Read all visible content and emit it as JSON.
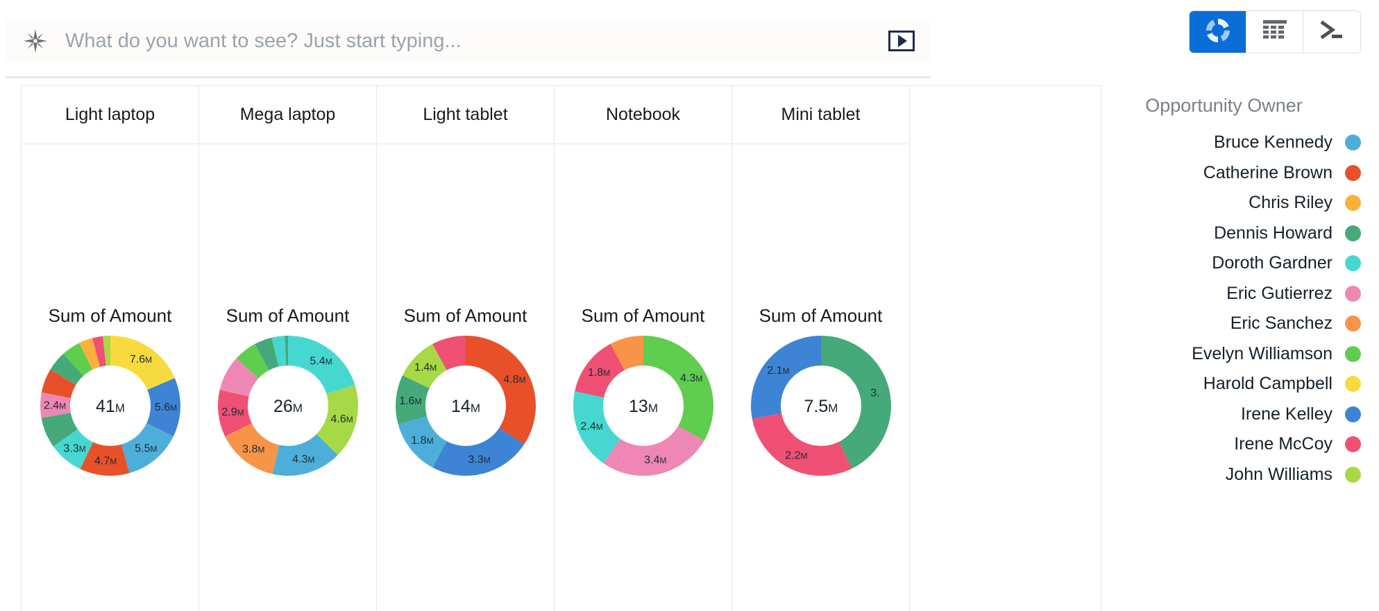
{
  "search": {
    "placeholder": "What do you want to see? Just start typing...",
    "value": "",
    "icon": "sparkle-icon",
    "run_icon": "play-icon"
  },
  "view_switch": {
    "buttons": [
      {
        "name": "chart-view",
        "icon": "donut-chart-icon",
        "active": true
      },
      {
        "name": "table-view",
        "icon": "table-grid-icon",
        "active": false
      },
      {
        "name": "console-view",
        "icon": "terminal-prompt-icon",
        "active": false
      }
    ],
    "active_color": "#0a6ed6"
  },
  "legend": {
    "title": "Opportunity Owner",
    "items": [
      {
        "label": "Bruce Kennedy",
        "color": "#4dafd9"
      },
      {
        "label": "Catherine Brown",
        "color": "#e8502a"
      },
      {
        "label": "Chris Riley",
        "color": "#fbb03b"
      },
      {
        "label": "Dennis Howard",
        "color": "#45a97a"
      },
      {
        "label": "Doroth Gardner",
        "color": "#46d8d0"
      },
      {
        "label": "Eric Gutierrez",
        "color": "#ee87b4"
      },
      {
        "label": "Eric Sanchez",
        "color": "#f79448"
      },
      {
        "label": "Evelyn Williamson",
        "color": "#5fcd4e"
      },
      {
        "label": "Harold Campbell",
        "color": "#f7da3e"
      },
      {
        "label": "Irene Kelley",
        "color": "#3d84d4"
      },
      {
        "label": "Irene McCoy",
        "color": "#ef5073"
      },
      {
        "label": "John Williams",
        "color": "#a6d945"
      }
    ]
  },
  "chart_data": {
    "type": "pie",
    "title": "Sum of Amount by Opportunity Owner and Product",
    "measure_label": "Sum of Amount",
    "dimension_label": "Opportunity Owner",
    "categories": [
      "Light laptop",
      "Mega laptop",
      "Light tablet",
      "Notebook",
      "Mini tablet"
    ],
    "charts": [
      {
        "category": "Light laptop",
        "title": "Sum of Amount",
        "total": "41",
        "total_suffix": "M",
        "slices": [
          {
            "owner": "Harold Campbell",
            "color": "#f7da3e",
            "value": 7.6,
            "label": "7.6",
            "suffix": "M",
            "show_label": true
          },
          {
            "owner": "Irene Kelley",
            "color": "#3d84d4",
            "value": 5.6,
            "label": "5.6",
            "suffix": "M",
            "show_label": true
          },
          {
            "owner": "Bruce Kennedy",
            "color": "#4dafd9",
            "value": 5.5,
            "label": "5.5",
            "suffix": "M",
            "show_label": true
          },
          {
            "owner": "Catherine Brown",
            "color": "#e8502a",
            "value": 4.7,
            "label": "4.7",
            "suffix": "M",
            "show_label": true
          },
          {
            "owner": "Doroth Gardner",
            "color": "#46d8d0",
            "value": 3.3,
            "label": "3.3",
            "suffix": "M",
            "show_label": true
          },
          {
            "owner": "Dennis Howard",
            "color": "#45a97a",
            "value": 2.9,
            "label": "",
            "suffix": "",
            "show_label": false
          },
          {
            "owner": "Eric Gutierrez",
            "color": "#ee87b4",
            "value": 2.4,
            "label": "2.4",
            "suffix": "M",
            "show_label": true
          },
          {
            "owner": "Catherine Brown",
            "color": "#e8502a",
            "value": 2.3,
            "label": "",
            "suffix": "",
            "show_label": false
          },
          {
            "owner": "Dennis Howard",
            "color": "#45a97a",
            "value": 1.9,
            "label": "",
            "suffix": "",
            "show_label": false
          },
          {
            "owner": "Evelyn Williamson",
            "color": "#5fcd4e",
            "value": 1.8,
            "label": "",
            "suffix": "",
            "show_label": false
          },
          {
            "owner": "Chris Riley",
            "color": "#fbb03b",
            "value": 1.3,
            "label": "",
            "suffix": "",
            "show_label": false
          },
          {
            "owner": "Irene McCoy",
            "color": "#ef5073",
            "value": 1.0,
            "label": "",
            "suffix": "",
            "show_label": false
          },
          {
            "owner": "John Williams",
            "color": "#a6d945",
            "value": 0.7,
            "label": "",
            "suffix": "",
            "show_label": false
          }
        ]
      },
      {
        "category": "Mega laptop",
        "title": "Sum of Amount",
        "total": "26",
        "total_suffix": "M",
        "slices": [
          {
            "owner": "Doroth Gardner",
            "color": "#46d8d0",
            "value": 5.4,
            "label": "5.4",
            "suffix": "M",
            "show_label": true
          },
          {
            "owner": "John Williams",
            "color": "#a6d945",
            "value": 4.6,
            "label": "4.6",
            "suffix": "M",
            "show_label": true
          },
          {
            "owner": "Bruce Kennedy",
            "color": "#4dafd9",
            "value": 4.3,
            "label": "4.3",
            "suffix": "M",
            "show_label": true
          },
          {
            "owner": "Eric Sanchez",
            "color": "#f79448",
            "value": 3.8,
            "label": "3.8",
            "suffix": "M",
            "show_label": true
          },
          {
            "owner": "Irene McCoy",
            "color": "#ef5073",
            "value": 2.9,
            "label": "2.9",
            "suffix": "M",
            "show_label": true
          },
          {
            "owner": "Eric Gutierrez",
            "color": "#ee87b4",
            "value": 2.2,
            "label": "",
            "suffix": "",
            "show_label": false
          },
          {
            "owner": "Evelyn Williamson",
            "color": "#5fcd4e",
            "value": 1.4,
            "label": "",
            "suffix": "",
            "show_label": false
          },
          {
            "owner": "Dennis Howard",
            "color": "#45a97a",
            "value": 1.1,
            "label": "",
            "suffix": "",
            "show_label": false
          },
          {
            "owner": "Doroth Gardner",
            "color": "#46d8d0",
            "value": 0.8,
            "label": "",
            "suffix": "",
            "show_label": false
          },
          {
            "owner": "Dennis Howard",
            "color": "#45a97a",
            "value": 0.2,
            "label": "",
            "suffix": "",
            "show_label": false
          }
        ]
      },
      {
        "category": "Light tablet",
        "title": "Sum of Amount",
        "total": "14",
        "total_suffix": "M",
        "slices": [
          {
            "owner": "Catherine Brown",
            "color": "#e8502a",
            "value": 4.8,
            "label": "4.8",
            "suffix": "M",
            "show_label": true
          },
          {
            "owner": "Irene Kelley",
            "color": "#3d84d4",
            "value": 3.3,
            "label": "3.3",
            "suffix": "M",
            "show_label": true
          },
          {
            "owner": "Bruce Kennedy",
            "color": "#4dafd9",
            "value": 1.8,
            "label": "1.8",
            "suffix": "M",
            "show_label": true
          },
          {
            "owner": "Dennis Howard",
            "color": "#45a97a",
            "value": 1.6,
            "label": "1.6",
            "suffix": "M",
            "show_label": true
          },
          {
            "owner": "John Williams",
            "color": "#a6d945",
            "value": 1.4,
            "label": "1.4",
            "suffix": "M",
            "show_label": true
          },
          {
            "owner": "Irene McCoy",
            "color": "#ef5073",
            "value": 1.1,
            "label": "",
            "suffix": "",
            "show_label": false
          }
        ]
      },
      {
        "category": "Notebook",
        "title": "Sum of Amount",
        "total": "13",
        "total_suffix": "M",
        "slices": [
          {
            "owner": "Evelyn Williamson",
            "color": "#5fcd4e",
            "value": 4.3,
            "label": "4.3",
            "suffix": "M",
            "show_label": true
          },
          {
            "owner": "Eric Gutierrez",
            "color": "#ee87b4",
            "value": 3.4,
            "label": "3.4",
            "suffix": "M",
            "show_label": true
          },
          {
            "owner": "Doroth Gardner",
            "color": "#46d8d0",
            "value": 2.4,
            "label": "2.4",
            "suffix": "M",
            "show_label": true
          },
          {
            "owner": "Irene McCoy",
            "color": "#ef5073",
            "value": 1.8,
            "label": "1.8",
            "suffix": "M",
            "show_label": true
          },
          {
            "owner": "Eric Sanchez",
            "color": "#f79448",
            "value": 1.0,
            "label": "",
            "suffix": "",
            "show_label": false
          }
        ]
      },
      {
        "category": "Mini tablet",
        "title": "Sum of Amount",
        "total": "7.5",
        "total_suffix": "M",
        "slices": [
          {
            "owner": "Dennis Howard",
            "color": "#45a97a",
            "value": 3.2,
            "label": "3.",
            "suffix": "",
            "show_label": true
          },
          {
            "owner": "Irene McCoy",
            "color": "#ef5073",
            "value": 2.2,
            "label": "2.2",
            "suffix": "M",
            "show_label": true
          },
          {
            "owner": "Irene Kelley",
            "color": "#3d84d4",
            "value": 2.1,
            "label": "2.1",
            "suffix": "M",
            "show_label": true
          }
        ]
      }
    ]
  }
}
